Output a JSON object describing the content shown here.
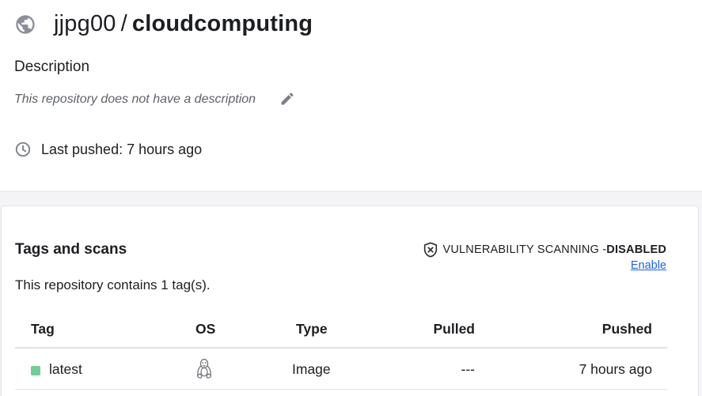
{
  "header": {
    "owner": "jjpg00",
    "separator": "/",
    "repo": "cloudcomputing",
    "icon": "globe-icon"
  },
  "description": {
    "heading": "Description",
    "text": "This repository does not have a description",
    "edit_icon": "pencil-icon"
  },
  "last_pushed": {
    "text": "Last pushed: 7 hours ago",
    "icon": "clock-icon"
  },
  "tags": {
    "heading": "Tags and scans",
    "scanning_label": "VULNERABILITY SCANNING - ",
    "scanning_status": "DISABLED",
    "enable_link": "Enable",
    "count_text": "This repository contains 1 tag(s).",
    "columns": [
      "Tag",
      "OS",
      "Type",
      "Pulled",
      "Pushed"
    ],
    "rows": [
      {
        "tag": "latest",
        "os_icon": "linux-icon",
        "type": "Image",
        "pulled": "---",
        "pushed": "7 hours ago",
        "status_color": "#6fcf97"
      }
    ]
  },
  "colors": {
    "link": "#1d63ed",
    "background": "#f4f4f6",
    "accent_green": "#6fcf97"
  }
}
